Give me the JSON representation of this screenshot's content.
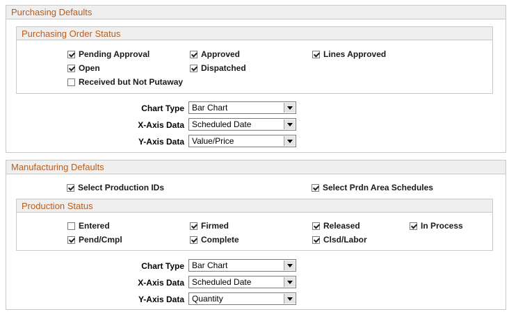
{
  "purchasing": {
    "title": "Purchasing Defaults",
    "order_status": {
      "title": "Purchasing Order Status",
      "items": [
        {
          "label": "Pending Approval",
          "checked": true
        },
        {
          "label": "Approved",
          "checked": true
        },
        {
          "label": "Lines Approved",
          "checked": true
        },
        {
          "label": "Open",
          "checked": true
        },
        {
          "label": "Dispatched",
          "checked": true
        },
        {
          "label": "Received but Not Putaway",
          "checked": false
        }
      ]
    },
    "fields": [
      {
        "label": "Chart Type",
        "value": "Bar Chart"
      },
      {
        "label": "X-Axis Data",
        "value": "Scheduled Date"
      },
      {
        "label": "Y-Axis Data",
        "value": "Value/Price"
      }
    ]
  },
  "manufacturing": {
    "title": "Manufacturing Defaults",
    "options": [
      {
        "label": "Select Production IDs",
        "checked": true
      },
      {
        "label": "Select Prdn Area Schedules",
        "checked": true
      }
    ],
    "production_status": {
      "title": "Production Status",
      "items": [
        {
          "label": "Entered",
          "checked": false
        },
        {
          "label": "Firmed",
          "checked": true
        },
        {
          "label": "Released",
          "checked": true
        },
        {
          "label": "In Process",
          "checked": true
        },
        {
          "label": "Pend/Cmpl",
          "checked": true
        },
        {
          "label": "Complete",
          "checked": true
        },
        {
          "label": "Clsd/Labor",
          "checked": true
        }
      ]
    },
    "fields": [
      {
        "label": "Chart Type",
        "value": "Bar Chart"
      },
      {
        "label": "X-Axis Data",
        "value": "Scheduled Date"
      },
      {
        "label": "Y-Axis Data",
        "value": "Quantity"
      }
    ]
  }
}
